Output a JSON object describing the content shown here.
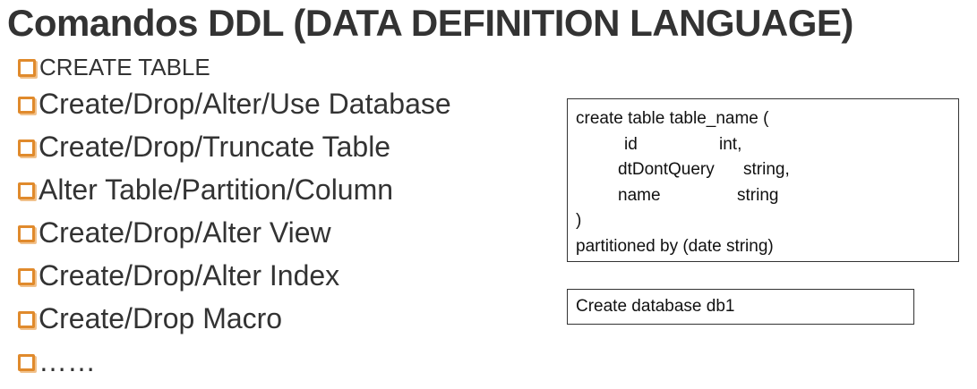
{
  "title": "Comandos DDL (DATA DEFINITION LANGUAGE)",
  "bullets": [
    "CREATE TABLE",
    "Create/Drop/Alter/Use Database",
    "Create/Drop/Truncate Table",
    "Alter Table/Partition/Column",
    "Create/Drop/Alter View",
    "Create/Drop/Alter Index",
    "Create/Drop Macro",
    "……"
  ],
  "code_box": {
    "line1": "create table table_name (",
    "row_id": {
      "name": "id",
      "type": "int,"
    },
    "row_dt": {
      "name": "dtDontQuery",
      "type": "string,"
    },
    "row_name": {
      "name": "name",
      "type": "string"
    },
    "line5": ")",
    "line6": "partitioned by (date string)"
  },
  "db_box": {
    "text": "Create database db1"
  },
  "colors": {
    "bullet_icon": "#e08a2c",
    "text": "#333333"
  },
  "icons": {
    "bullet": "checkbox-square-icon"
  }
}
